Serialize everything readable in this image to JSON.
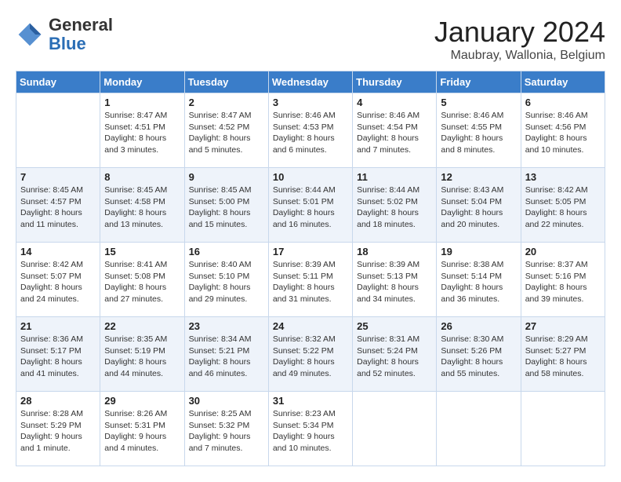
{
  "header": {
    "logo_general": "General",
    "logo_blue": "Blue",
    "month_title": "January 2024",
    "location": "Maubray, Wallonia, Belgium"
  },
  "days_of_week": [
    "Sunday",
    "Monday",
    "Tuesday",
    "Wednesday",
    "Thursday",
    "Friday",
    "Saturday"
  ],
  "weeks": [
    [
      {
        "day": "",
        "info": ""
      },
      {
        "day": "1",
        "info": "Sunrise: 8:47 AM\nSunset: 4:51 PM\nDaylight: 8 hours\nand 3 minutes."
      },
      {
        "day": "2",
        "info": "Sunrise: 8:47 AM\nSunset: 4:52 PM\nDaylight: 8 hours\nand 5 minutes."
      },
      {
        "day": "3",
        "info": "Sunrise: 8:46 AM\nSunset: 4:53 PM\nDaylight: 8 hours\nand 6 minutes."
      },
      {
        "day": "4",
        "info": "Sunrise: 8:46 AM\nSunset: 4:54 PM\nDaylight: 8 hours\nand 7 minutes."
      },
      {
        "day": "5",
        "info": "Sunrise: 8:46 AM\nSunset: 4:55 PM\nDaylight: 8 hours\nand 8 minutes."
      },
      {
        "day": "6",
        "info": "Sunrise: 8:46 AM\nSunset: 4:56 PM\nDaylight: 8 hours\nand 10 minutes."
      }
    ],
    [
      {
        "day": "7",
        "info": "Sunrise: 8:45 AM\nSunset: 4:57 PM\nDaylight: 8 hours\nand 11 minutes."
      },
      {
        "day": "8",
        "info": "Sunrise: 8:45 AM\nSunset: 4:58 PM\nDaylight: 8 hours\nand 13 minutes."
      },
      {
        "day": "9",
        "info": "Sunrise: 8:45 AM\nSunset: 5:00 PM\nDaylight: 8 hours\nand 15 minutes."
      },
      {
        "day": "10",
        "info": "Sunrise: 8:44 AM\nSunset: 5:01 PM\nDaylight: 8 hours\nand 16 minutes."
      },
      {
        "day": "11",
        "info": "Sunrise: 8:44 AM\nSunset: 5:02 PM\nDaylight: 8 hours\nand 18 minutes."
      },
      {
        "day": "12",
        "info": "Sunrise: 8:43 AM\nSunset: 5:04 PM\nDaylight: 8 hours\nand 20 minutes."
      },
      {
        "day": "13",
        "info": "Sunrise: 8:42 AM\nSunset: 5:05 PM\nDaylight: 8 hours\nand 22 minutes."
      }
    ],
    [
      {
        "day": "14",
        "info": "Sunrise: 8:42 AM\nSunset: 5:07 PM\nDaylight: 8 hours\nand 24 minutes."
      },
      {
        "day": "15",
        "info": "Sunrise: 8:41 AM\nSunset: 5:08 PM\nDaylight: 8 hours\nand 27 minutes."
      },
      {
        "day": "16",
        "info": "Sunrise: 8:40 AM\nSunset: 5:10 PM\nDaylight: 8 hours\nand 29 minutes."
      },
      {
        "day": "17",
        "info": "Sunrise: 8:39 AM\nSunset: 5:11 PM\nDaylight: 8 hours\nand 31 minutes."
      },
      {
        "day": "18",
        "info": "Sunrise: 8:39 AM\nSunset: 5:13 PM\nDaylight: 8 hours\nand 34 minutes."
      },
      {
        "day": "19",
        "info": "Sunrise: 8:38 AM\nSunset: 5:14 PM\nDaylight: 8 hours\nand 36 minutes."
      },
      {
        "day": "20",
        "info": "Sunrise: 8:37 AM\nSunset: 5:16 PM\nDaylight: 8 hours\nand 39 minutes."
      }
    ],
    [
      {
        "day": "21",
        "info": "Sunrise: 8:36 AM\nSunset: 5:17 PM\nDaylight: 8 hours\nand 41 minutes."
      },
      {
        "day": "22",
        "info": "Sunrise: 8:35 AM\nSunset: 5:19 PM\nDaylight: 8 hours\nand 44 minutes."
      },
      {
        "day": "23",
        "info": "Sunrise: 8:34 AM\nSunset: 5:21 PM\nDaylight: 8 hours\nand 46 minutes."
      },
      {
        "day": "24",
        "info": "Sunrise: 8:32 AM\nSunset: 5:22 PM\nDaylight: 8 hours\nand 49 minutes."
      },
      {
        "day": "25",
        "info": "Sunrise: 8:31 AM\nSunset: 5:24 PM\nDaylight: 8 hours\nand 52 minutes."
      },
      {
        "day": "26",
        "info": "Sunrise: 8:30 AM\nSunset: 5:26 PM\nDaylight: 8 hours\nand 55 minutes."
      },
      {
        "day": "27",
        "info": "Sunrise: 8:29 AM\nSunset: 5:27 PM\nDaylight: 8 hours\nand 58 minutes."
      }
    ],
    [
      {
        "day": "28",
        "info": "Sunrise: 8:28 AM\nSunset: 5:29 PM\nDaylight: 9 hours\nand 1 minute."
      },
      {
        "day": "29",
        "info": "Sunrise: 8:26 AM\nSunset: 5:31 PM\nDaylight: 9 hours\nand 4 minutes."
      },
      {
        "day": "30",
        "info": "Sunrise: 8:25 AM\nSunset: 5:32 PM\nDaylight: 9 hours\nand 7 minutes."
      },
      {
        "day": "31",
        "info": "Sunrise: 8:23 AM\nSunset: 5:34 PM\nDaylight: 9 hours\nand 10 minutes."
      },
      {
        "day": "",
        "info": ""
      },
      {
        "day": "",
        "info": ""
      },
      {
        "day": "",
        "info": ""
      }
    ]
  ]
}
